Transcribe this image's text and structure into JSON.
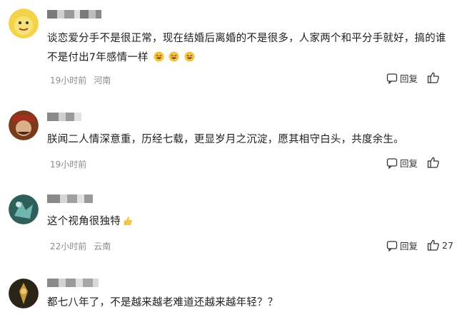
{
  "comments": [
    {
      "text": "谈恋爱分手不是很正常，现在结婚后离婚的不是很多，人家两个和平分手就好，搞的谁不是付出7年感情一样",
      "emoji_count": 3,
      "time": "19小时前",
      "location": "河南",
      "reply_label": "回复",
      "likes": ""
    },
    {
      "text": "朕闻二人情深意重，历经七载，更显岁月之沉淀，愿其相守白头，共度余生。",
      "time": "19小时前",
      "location": "",
      "reply_label": "回复",
      "likes": ""
    },
    {
      "text": "这个视角很独特",
      "time": "22小时前",
      "location": "云南",
      "reply_label": "回复",
      "likes": "27"
    },
    {
      "text": "都七八年了，不是越来越老难道还越来越年轻？？",
      "time": "",
      "location": "",
      "reply_label": "",
      "likes": ""
    }
  ],
  "colors": {
    "meta_gray": "#8b8b8b",
    "text": "#1e1e1e"
  },
  "icons": {
    "reply": "comment-bubble-icon",
    "like": "thumbs-up-icon",
    "emoji_laugh": "laughing-emoji-icon",
    "emoji_thumb": "thumbs-up-emoji-icon"
  }
}
